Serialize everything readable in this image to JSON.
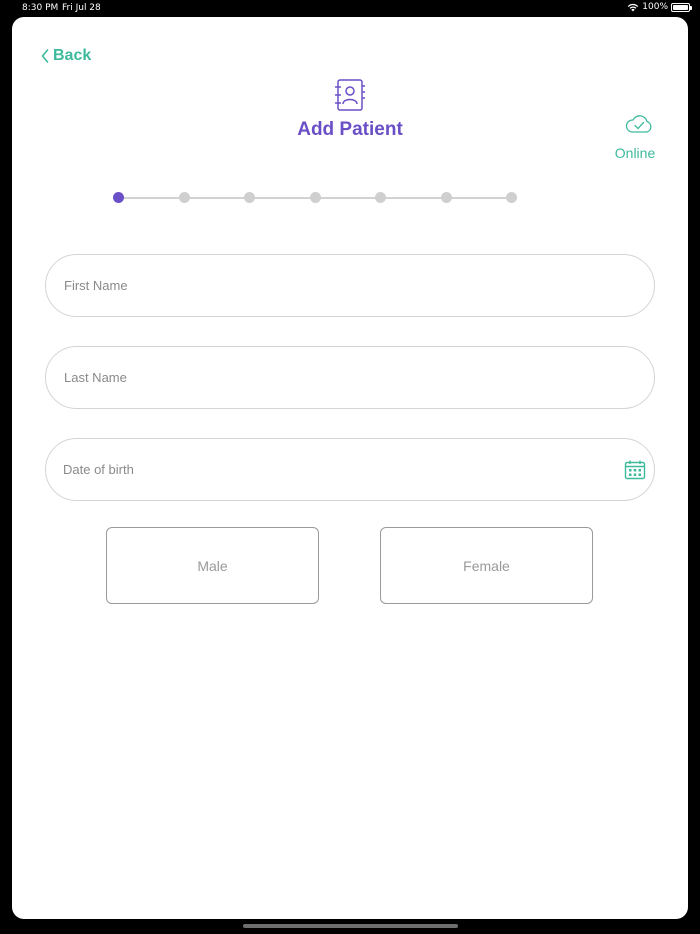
{
  "status_bar": {
    "time": "8:30 PM",
    "date": "Fri Jul 28",
    "battery": "100%"
  },
  "nav": {
    "back_label": "Back"
  },
  "header": {
    "title": "Add Patient",
    "title_icon": "contact-book-icon",
    "connection_status": "Online",
    "connection_icon": "cloud-check-icon"
  },
  "stepper": {
    "total_steps": 7,
    "current_step": 1
  },
  "form": {
    "first_name": {
      "value": "",
      "placeholder": "First Name"
    },
    "last_name": {
      "value": "",
      "placeholder": "Last Name"
    },
    "date_of_birth": {
      "value": "",
      "placeholder": "Date of birth",
      "icon": "calendar-icon"
    }
  },
  "gender": {
    "male_label": "Male",
    "female_label": "Female"
  },
  "colors": {
    "accent_purple": "#6a4fc7",
    "accent_green": "#3dba9c",
    "inactive_gray": "#cfcfcf"
  }
}
